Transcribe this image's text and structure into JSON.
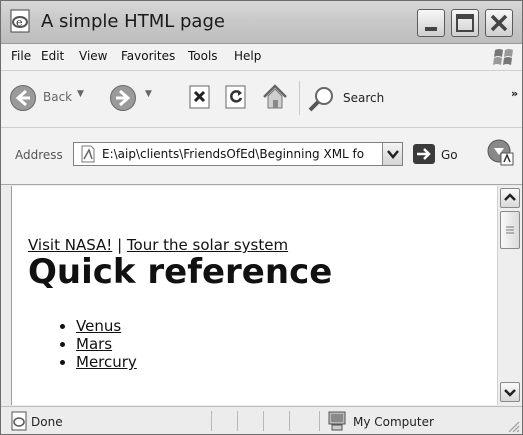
{
  "window": {
    "title": "A simple HTML page"
  },
  "menu": {
    "items": [
      "File",
      "Edit",
      "View",
      "Favorites",
      "Tools",
      "Help"
    ]
  },
  "toolbar": {
    "back_label": "Back",
    "search_label": "Search",
    "more_label": "»"
  },
  "address": {
    "label": "Address",
    "url": "E:\\aip\\clients\\FriendsOfEd\\Beginning XML fo",
    "go_label": "Go"
  },
  "content": {
    "link_visit": "Visit NASA!",
    "separator": "|",
    "link_tour": "Tour the solar system",
    "heading": "Quick reference",
    "planets": [
      "Venus",
      "Mars",
      "Mercury"
    ]
  },
  "status": {
    "text": "Done",
    "zone": "My Computer"
  },
  "icons": {
    "app": "ie-page-icon",
    "minimize": "minimize-icon",
    "maximize": "maximize-icon",
    "close": "close-icon",
    "throbber": "windows-flag-icon",
    "back": "back-arrow-icon",
    "forward": "forward-arrow-icon",
    "stop": "stop-icon",
    "refresh": "refresh-icon",
    "home": "home-icon",
    "search": "search-icon",
    "page": "page-icon",
    "go": "go-arrow-icon",
    "media": "media-icon",
    "computer": "computer-icon"
  }
}
